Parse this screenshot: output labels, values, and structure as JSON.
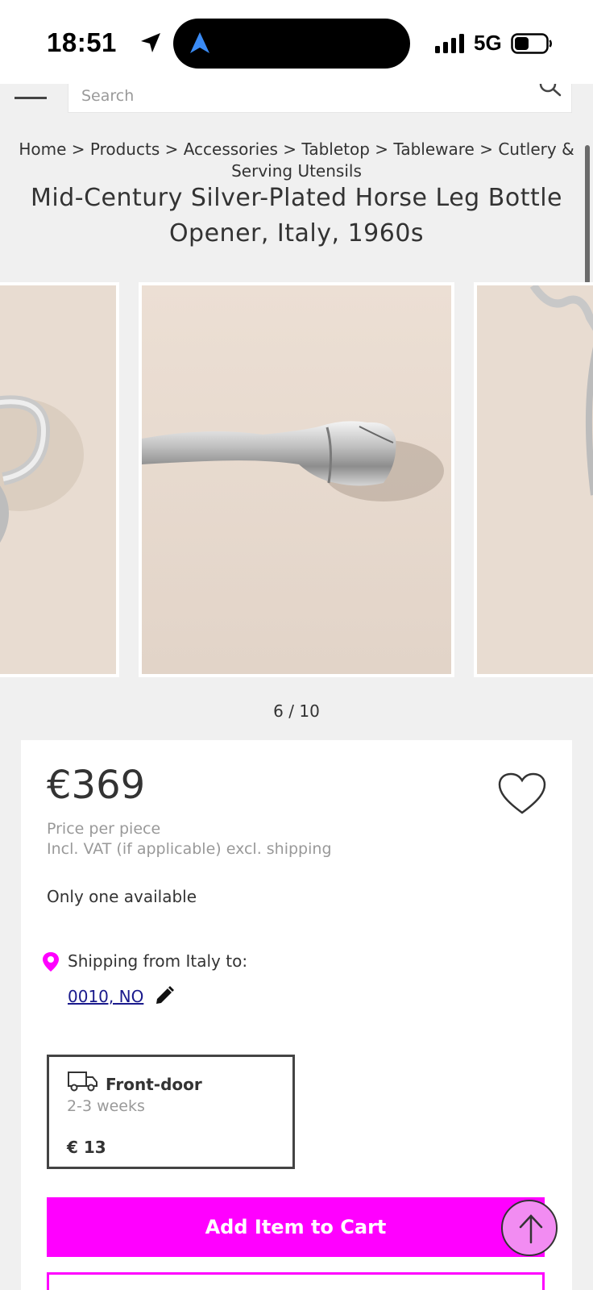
{
  "status_bar": {
    "time": "18:51",
    "network": "5G"
  },
  "search": {
    "placeholder": "Search"
  },
  "breadcrumb": {
    "items": [
      "Home",
      "Products",
      "Accessories",
      "Tabletop",
      "Tableware",
      "Cutlery & Serving Utensils"
    ],
    "separator": ">"
  },
  "product": {
    "title": "Mid-Century Silver-Plated Horse Leg Bottle Opener, Italy, 1960s",
    "price": "€369",
    "price_unit": "Price per piece",
    "price_note": "Incl. VAT (if applicable) excl. shipping",
    "availability": "Only one available"
  },
  "gallery": {
    "counter": "6 / 10",
    "current": 6,
    "total": 10
  },
  "shipping": {
    "from_label": "Shipping from Italy to:",
    "destination": "0010, NO",
    "option": {
      "name": "Front-door",
      "time": "2-3 weeks",
      "price": "€ 13"
    }
  },
  "actions": {
    "add_to_cart": "Add Item to Cart"
  },
  "colors": {
    "accent": "#ff00ff",
    "background": "#f0f0f0",
    "card": "#ffffff",
    "link": "#1a1a8c"
  },
  "icons": [
    "location-arrow-icon",
    "navigation-icon",
    "signal-icon",
    "battery-icon",
    "menu-icon",
    "search-icon",
    "heart-icon",
    "location-pin-icon",
    "pencil-icon",
    "truck-icon",
    "arrow-up-icon"
  ]
}
